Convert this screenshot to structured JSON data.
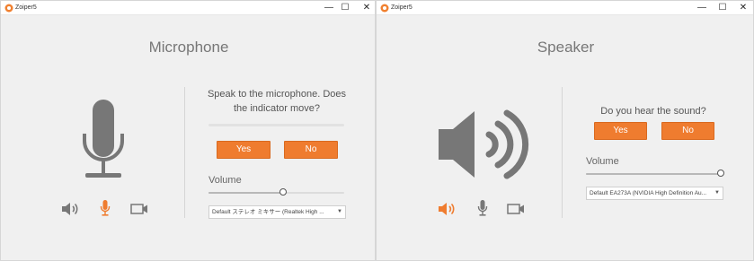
{
  "left_window": {
    "app_name": "Zoiper5",
    "controls": {
      "minimize": "—",
      "maximize": "☐",
      "close": "✕"
    },
    "heading": "Microphone",
    "prompt": "Speak to the microphone. Does the indicator move?",
    "mic_level": 0.0,
    "yes_label": "Yes",
    "no_label": "No",
    "volume_label": "Volume",
    "volume_level": 0.55,
    "device": "Default ステレオ ミキサー (Realtek High ...",
    "active_tab": "microphone",
    "colors": {
      "accent": "#ef7c2f",
      "icon": "#777777"
    }
  },
  "right_window": {
    "app_name": "Zoiper5",
    "controls": {
      "minimize": "—",
      "maximize": "☐",
      "close": "✕"
    },
    "heading": "Speaker",
    "prompt": "Do you hear the sound?",
    "yes_label": "Yes",
    "no_label": "No",
    "volume_label": "Volume",
    "volume_level": 1.0,
    "device": "Default EA273A (NVIDIA High Definition Au...",
    "active_tab": "speaker"
  }
}
